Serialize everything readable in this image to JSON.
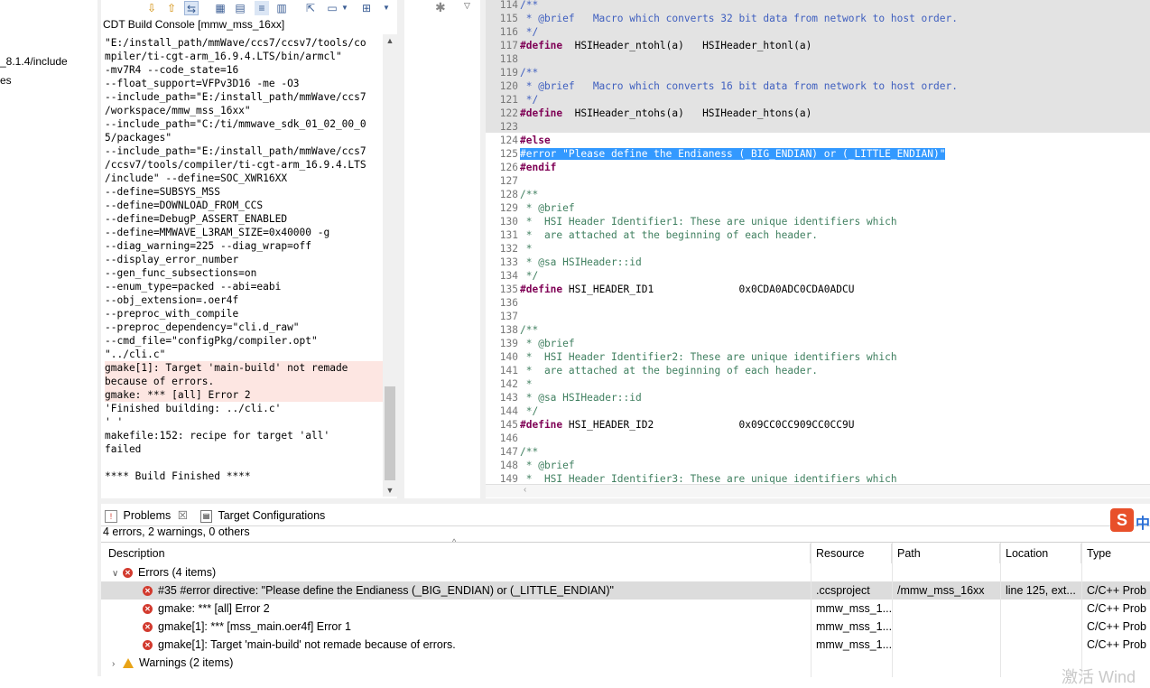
{
  "left_strip": {
    "lines": [
      "_8.1.4/include",
      "es"
    ]
  },
  "console": {
    "title": "CDT Build Console [mmw_mss_16xx]",
    "lines": [
      {
        "text": "\"E:/install_path/mmWave/ccs7/ccsv7/tools/co",
        "err": false
      },
      {
        "text": "mpiler/ti-cgt-arm_16.9.4.LTS/bin/armcl\"",
        "err": false
      },
      {
        "text": "-mv7R4 --code_state=16",
        "err": false
      },
      {
        "text": "--float_support=VFPv3D16 -me -O3",
        "err": false
      },
      {
        "text": "--include_path=\"E:/install_path/mmWave/ccs7",
        "err": false
      },
      {
        "text": "/workspace/mmw_mss_16xx\"",
        "err": false
      },
      {
        "text": "--include_path=\"C:/ti/mmwave_sdk_01_02_00_0",
        "err": false
      },
      {
        "text": "5/packages\"",
        "err": false
      },
      {
        "text": "--include_path=\"E:/install_path/mmWave/ccs7",
        "err": false
      },
      {
        "text": "/ccsv7/tools/compiler/ti-cgt-arm_16.9.4.LTS",
        "err": false
      },
      {
        "text": "/include\" --define=SOC_XWR16XX",
        "err": false
      },
      {
        "text": "--define=SUBSYS_MSS",
        "err": false
      },
      {
        "text": "--define=DOWNLOAD_FROM_CCS",
        "err": false
      },
      {
        "text": "--define=DebugP_ASSERT_ENABLED",
        "err": false
      },
      {
        "text": "--define=MMWAVE_L3RAM_SIZE=0x40000 -g",
        "err": false
      },
      {
        "text": "--diag_warning=225 --diag_wrap=off",
        "err": false
      },
      {
        "text": "--display_error_number",
        "err": false
      },
      {
        "text": "--gen_func_subsections=on",
        "err": false
      },
      {
        "text": "--enum_type=packed --abi=eabi",
        "err": false
      },
      {
        "text": "--obj_extension=.oer4f",
        "err": false
      },
      {
        "text": "--preproc_with_compile",
        "err": false
      },
      {
        "text": "--preproc_dependency=\"cli.d_raw\"",
        "err": false
      },
      {
        "text": "--cmd_file=\"configPkg/compiler.opt\"",
        "err": false
      },
      {
        "text": "\"../cli.c\"",
        "err": false
      },
      {
        "text": "gmake[1]: Target 'main-build' not remade",
        "err": true
      },
      {
        "text": "because of errors.",
        "err": true
      },
      {
        "text": "gmake: *** [all] Error 2",
        "err": true
      },
      {
        "text": "'Finished building: ../cli.c'",
        "err": false
      },
      {
        "text": "' '",
        "err": false
      },
      {
        "text": "makefile:152: recipe for target 'all'",
        "err": false
      },
      {
        "text": "failed",
        "err": false
      },
      {
        "text": "",
        "err": false
      },
      {
        "text": "**** Build Finished ****",
        "err": false
      }
    ]
  },
  "editor": {
    "lines": [
      {
        "n": "114",
        "parts": [
          {
            "t": "/**",
            "c": "dcm"
          }
        ]
      },
      {
        "n": "115",
        "parts": [
          {
            "t": " * @brief   Macro which converts 32 bit data from network to host order.",
            "c": "dcm"
          }
        ]
      },
      {
        "n": "116",
        "parts": [
          {
            "t": " */",
            "c": "dcm"
          }
        ]
      },
      {
        "n": "117",
        "parts": [
          {
            "t": "#define",
            "c": "kw"
          },
          {
            "t": "  HSIHeader_ntohl(a)   HSIHeader_htonl(a)",
            "c": ""
          }
        ]
      },
      {
        "n": "118",
        "parts": []
      },
      {
        "n": "119",
        "parts": [
          {
            "t": "/**",
            "c": "dcm"
          }
        ]
      },
      {
        "n": "120",
        "parts": [
          {
            "t": " * @brief   Macro which converts 16 bit data from network to host order.",
            "c": "dcm"
          }
        ]
      },
      {
        "n": "121",
        "parts": [
          {
            "t": " */",
            "c": "dcm"
          }
        ]
      },
      {
        "n": "122",
        "parts": [
          {
            "t": "#define",
            "c": "kw"
          },
          {
            "t": "  HSIHeader_ntohs(a)   HSIHeader_htons(a)",
            "c": ""
          }
        ]
      },
      {
        "n": "123",
        "parts": []
      },
      {
        "n": "124",
        "parts": [
          {
            "t": "#else",
            "c": "kw"
          }
        ]
      },
      {
        "n": "125",
        "parts": [
          {
            "t": "#error \"Please define the Endianess (_BIG_ENDIAN) or (_LITTLE_ENDIAN)\"",
            "c": "hl"
          }
        ]
      },
      {
        "n": "126",
        "parts": [
          {
            "t": "#endif",
            "c": "kw"
          }
        ]
      },
      {
        "n": "127",
        "parts": []
      },
      {
        "n": "128",
        "parts": [
          {
            "t": "/**",
            "c": "cm"
          }
        ]
      },
      {
        "n": "129",
        "parts": [
          {
            "t": " * @brief",
            "c": "cm"
          }
        ]
      },
      {
        "n": "130",
        "parts": [
          {
            "t": " *  HSI Header Identifier1: These are unique identifiers which",
            "c": "cm"
          }
        ]
      },
      {
        "n": "131",
        "parts": [
          {
            "t": " *  are attached at the beginning of each header.",
            "c": "cm"
          }
        ]
      },
      {
        "n": "132",
        "parts": [
          {
            "t": " *",
            "c": "cm"
          }
        ]
      },
      {
        "n": "133",
        "parts": [
          {
            "t": " * @sa HSIHeader::id",
            "c": "cm"
          }
        ]
      },
      {
        "n": "134",
        "parts": [
          {
            "t": " */",
            "c": "cm"
          }
        ]
      },
      {
        "n": "135",
        "parts": [
          {
            "t": "#define",
            "c": "kw"
          },
          {
            "t": " HSI_HEADER_ID1              0x0CDA0ADC0CDA0ADCU",
            "c": ""
          }
        ]
      },
      {
        "n": "136",
        "parts": []
      },
      {
        "n": "137",
        "parts": []
      },
      {
        "n": "138",
        "parts": [
          {
            "t": "/**",
            "c": "cm"
          }
        ]
      },
      {
        "n": "139",
        "parts": [
          {
            "t": " * @brief",
            "c": "cm"
          }
        ]
      },
      {
        "n": "140",
        "parts": [
          {
            "t": " *  HSI Header Identifier2: These are unique identifiers which",
            "c": "cm"
          }
        ]
      },
      {
        "n": "141",
        "parts": [
          {
            "t": " *  are attached at the beginning of each header.",
            "c": "cm"
          }
        ]
      },
      {
        "n": "142",
        "parts": [
          {
            "t": " *",
            "c": "cm"
          }
        ]
      },
      {
        "n": "143",
        "parts": [
          {
            "t": " * @sa HSIHeader::id",
            "c": "cm"
          }
        ]
      },
      {
        "n": "144",
        "parts": [
          {
            "t": " */",
            "c": "cm"
          }
        ]
      },
      {
        "n": "145",
        "parts": [
          {
            "t": "#define",
            "c": "kw"
          },
          {
            "t": " HSI_HEADER_ID2              0x09CC0CC909CC0CC9U",
            "c": ""
          }
        ]
      },
      {
        "n": "146",
        "parts": []
      },
      {
        "n": "147",
        "parts": [
          {
            "t": "/**",
            "c": "cm"
          }
        ]
      },
      {
        "n": "148",
        "parts": [
          {
            "t": " * @brief",
            "c": "cm"
          }
        ]
      },
      {
        "n": "149",
        "parts": [
          {
            "t": " *  HSI Header Identifier3: These are unique identifiers which",
            "c": "cm"
          }
        ]
      }
    ]
  },
  "problems": {
    "tabs": [
      {
        "label": "Problems",
        "icon": "problems-icon",
        "closable": true
      },
      {
        "label": "Target Configurations",
        "icon": "target-config-icon",
        "closable": false
      }
    ],
    "summary": "4 errors, 2 warnings, 0 others",
    "columns": [
      "Description",
      "Resource",
      "Path",
      "Location",
      "Type"
    ],
    "errors_group": "Errors (4 items)",
    "errors": [
      {
        "desc": "#35 #error directive: \"Please define the Endianess (_BIG_ENDIAN) or (_LITTLE_ENDIAN)\"",
        "resource": ".ccsproject",
        "path": "/mmw_mss_16xx",
        "location": "line 125, ext...",
        "type": "C/C++ Prob",
        "selected": true
      },
      {
        "desc": "gmake: *** [all] Error 2",
        "resource": "mmw_mss_1...",
        "path": "",
        "location": "",
        "type": "C/C++ Prob",
        "selected": false
      },
      {
        "desc": "gmake[1]: *** [mss_main.oer4f] Error 1",
        "resource": "mmw_mss_1...",
        "path": "",
        "location": "",
        "type": "C/C++ Prob",
        "selected": false
      },
      {
        "desc": "gmake[1]: Target 'main-build' not remade because of errors.",
        "resource": "mmw_mss_1...",
        "path": "",
        "location": "",
        "type": "C/C++ Prob",
        "selected": false
      }
    ],
    "warnings_group": "Warnings (2 items)"
  },
  "ime": {
    "logo": "S",
    "label": "中"
  },
  "watermark": "激活 Wind"
}
